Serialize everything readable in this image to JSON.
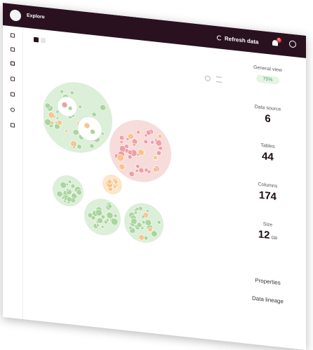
{
  "header": {
    "app_title": "Explore",
    "refresh_label": "Refresh data",
    "notification_count": "6"
  },
  "sidebar": {
    "items": [
      "catalog",
      "plug",
      "search",
      "share",
      "shield",
      "globe",
      "document"
    ],
    "active": "search"
  },
  "view_toggle": {
    "selected": "bubbles"
  },
  "stats": {
    "general_view_label": "General view",
    "general_view_value": "75%",
    "data_source_label": "Data source",
    "data_source_value": "6",
    "tables_label": "Tables",
    "tables_value": "44",
    "columns_label": "Columns",
    "columns_value": "174",
    "size_label": "Size",
    "size_value": "12",
    "size_unit": "GB"
  },
  "links": {
    "properties": "Properties",
    "data_lineage": "Data lineage"
  },
  "colors": {
    "header_bg": "#2a1120",
    "green_fill": "#dcefd8",
    "green_node": "#a9d59e",
    "red_fill": "#f7dcdc",
    "red_node": "#ee9fa5",
    "orange_node": "#f8c58d",
    "badge": "#e5394b"
  },
  "clusters": [
    {
      "id": "c1",
      "color": "green",
      "inner_color": "green"
    },
    {
      "id": "c2",
      "color": "red",
      "inner_color": "red"
    },
    {
      "id": "c3",
      "color": "orange",
      "inner_color": "orange"
    },
    {
      "id": "c4",
      "color": "green",
      "inner_color": "green"
    },
    {
      "id": "c5",
      "color": "green",
      "inner_color": "green"
    },
    {
      "id": "c6",
      "color": "green",
      "inner_color": "green"
    }
  ]
}
